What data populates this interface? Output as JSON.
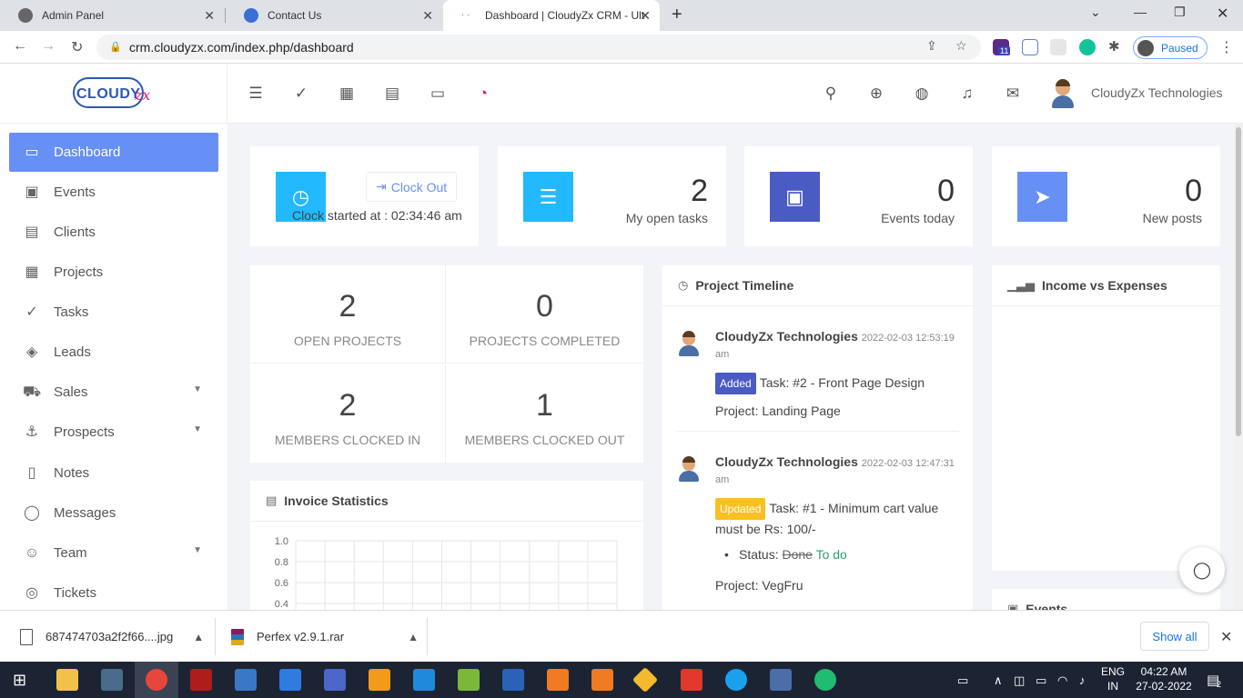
{
  "browser": {
    "tabs": [
      {
        "title": "Admin Panel"
      },
      {
        "title": "Contact Us"
      },
      {
        "title": "Dashboard | CloudyZx CRM - Ulti"
      }
    ],
    "url": "crm.cloudyzx.com/index.php/dashboard",
    "profile_status": "Paused",
    "extension_badge": "11"
  },
  "header": {
    "logo_text": "CLOUDY",
    "logo_suffix": "zx",
    "user_name": "CloudyZx Technologies"
  },
  "sidebar": {
    "items": [
      {
        "label": "Dashboard",
        "icon": "monitor-icon",
        "active": true
      },
      {
        "label": "Events",
        "icon": "calendar-icon"
      },
      {
        "label": "Clients",
        "icon": "briefcase-icon"
      },
      {
        "label": "Projects",
        "icon": "grid-icon"
      },
      {
        "label": "Tasks",
        "icon": "check-circle-icon"
      },
      {
        "label": "Leads",
        "icon": "layers-icon"
      },
      {
        "label": "Sales",
        "icon": "cart-icon",
        "has_children": true
      },
      {
        "label": "Prospects",
        "icon": "anchor-icon",
        "has_children": true
      },
      {
        "label": "Notes",
        "icon": "book-icon"
      },
      {
        "label": "Messages",
        "icon": "message-icon"
      },
      {
        "label": "Team",
        "icon": "users-icon",
        "has_children": true
      },
      {
        "label": "Tickets",
        "icon": "lifebuoy-icon"
      }
    ]
  },
  "clock": {
    "button_label": "Clock Out",
    "started_text": "Clock started at : 02:34:46 am"
  },
  "stats": [
    {
      "value": "2",
      "label": "My open tasks",
      "color": "#22b9ff",
      "icon": "list-icon"
    },
    {
      "value": "0",
      "label": "Events today",
      "color": "#4a5bc4",
      "icon": "calendar-icon"
    },
    {
      "value": "0",
      "label": "New posts",
      "color": "#6690f4",
      "icon": "send-icon"
    }
  ],
  "projects": [
    {
      "value": "2",
      "label": "OPEN PROJECTS"
    },
    {
      "value": "0",
      "label": "PROJECTS COMPLETED"
    },
    {
      "value": "2",
      "label": "MEMBERS CLOCKED IN"
    },
    {
      "value": "1",
      "label": "MEMBERS CLOCKED OUT"
    }
  ],
  "invoice": {
    "title": "Invoice Statistics"
  },
  "chart_data": {
    "type": "line",
    "title": "",
    "xlabel": "",
    "ylabel": "",
    "ylim": [
      0.4,
      1.0
    ],
    "y_ticks": [
      "1.0",
      "0.8",
      "0.6",
      "0.4"
    ],
    "series": []
  },
  "timeline": {
    "title": "Project Timeline",
    "entries": [
      {
        "user": "CloudyZx Technologies",
        "date": "2022-02-03 12:53:19",
        "date_suffix": "am",
        "badge": "Added",
        "text": "Task: #2 - Front Page Design",
        "project": "Project: Landing Page"
      },
      {
        "user": "CloudyZx Technologies",
        "date": "2022-02-03 12:47:31",
        "date_suffix": "am",
        "badge": "Updated",
        "text": "Task: #1 - Minimum cart value must be Rs: 100/-",
        "status_label": "Status:",
        "status_old": "Done",
        "status_new": "To do",
        "project": "Project: VegFru"
      }
    ]
  },
  "income": {
    "title": "Income vs Expenses"
  },
  "events_card": {
    "title": "Events"
  },
  "downloads": {
    "items": [
      {
        "name": "687474703a2f2f66....jpg"
      },
      {
        "name": "Perfex v2.9.1.rar"
      }
    ],
    "show_all": "Show all"
  },
  "taskbar": {
    "lang_top": "ENG",
    "lang_bottom": "IN",
    "time": "04:22 AM",
    "date": "27-02-2022",
    "notifications": "2"
  }
}
